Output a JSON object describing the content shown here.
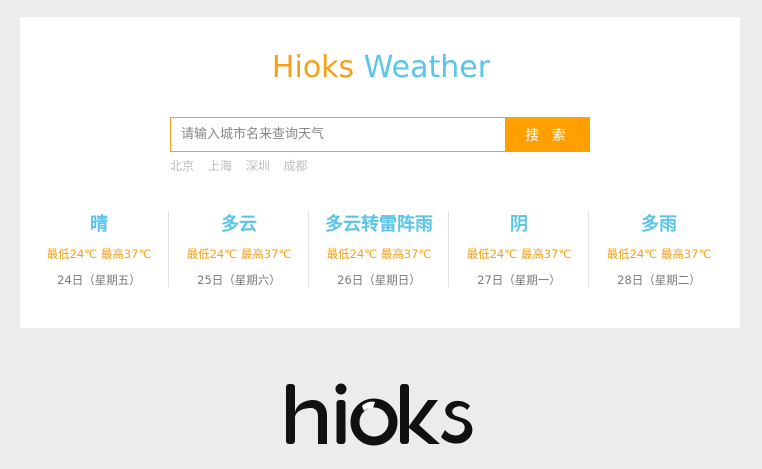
{
  "app": {
    "title_brand": "Hioks",
    "title_weather": "Weather"
  },
  "search": {
    "placeholder": "请输入城市名来查询天气",
    "value": "",
    "button_label": "搜 索"
  },
  "quick_cities": [
    "北京",
    "上海",
    "深圳",
    "成都"
  ],
  "forecast": [
    {
      "condition": "晴",
      "temps": "最低24℃ 最高37℃",
      "date": "24日（星期五）"
    },
    {
      "condition": "多云",
      "temps": "最低24℃ 最高37℃",
      "date": "25日（星期六）"
    },
    {
      "condition": "多云转雷阵雨",
      "temps": "最低24℃ 最高37℃",
      "date": "26日（星期日）"
    },
    {
      "condition": "阴",
      "temps": "最低24℃ 最高37℃",
      "date": "27日（星期一）"
    },
    {
      "condition": "多雨",
      "temps": "最低24℃ 最高37℃",
      "date": "28日（星期二）"
    }
  ],
  "footer_logo": {
    "text": "hioks",
    "icon": "hioks-logo"
  },
  "colors": {
    "brand_orange": "#f5a01a",
    "accent_blue": "#5bc4e8",
    "button_orange": "#ff9f00",
    "background": "#ececec"
  }
}
